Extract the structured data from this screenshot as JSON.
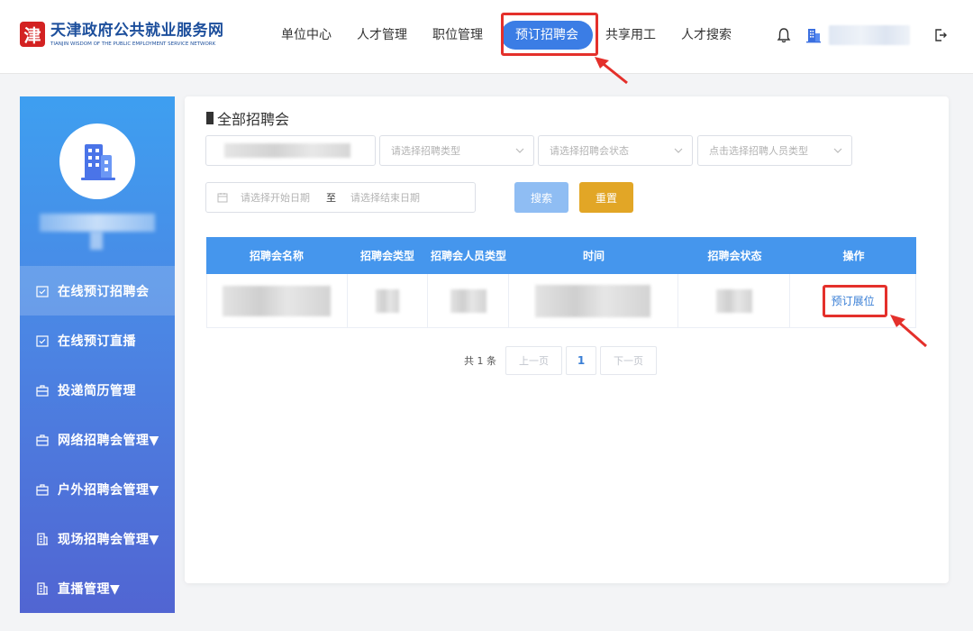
{
  "header": {
    "logo_mark": "津",
    "logo_cn": "天津政府公共就业服务网",
    "logo_en": "TIANJIN WISDOM OF THE PUBLIC EMPLOYMENT SERVICE NETWORK",
    "nav": [
      {
        "label": "单位中心"
      },
      {
        "label": "人才管理"
      },
      {
        "label": "职位管理"
      },
      {
        "label": "预订招聘会",
        "active": true
      },
      {
        "label": "共享用工"
      },
      {
        "label": "人才搜索"
      }
    ],
    "icons": [
      "bell-icon",
      "building-icon",
      "logout-icon"
    ]
  },
  "sidebar": {
    "items": [
      {
        "label": "在线预订招聘会",
        "icon": "calendar-check-icon",
        "active": true
      },
      {
        "label": "在线预订直播",
        "icon": "calendar-check-icon"
      },
      {
        "label": "投递简历管理",
        "icon": "briefcase-icon"
      },
      {
        "label": "网络招聘会管理▼",
        "icon": "briefcase-icon"
      },
      {
        "label": "户外招聘会管理▼",
        "icon": "briefcase-icon"
      },
      {
        "label": "现场招聘会管理▼",
        "icon": "building-icon"
      },
      {
        "label": "直播管理▼",
        "icon": "building-icon"
      }
    ]
  },
  "main": {
    "title": "全部招聘会",
    "filters": {
      "type_placeholder": "请选择招聘类型",
      "status_placeholder": "请选择招聘会状态",
      "person_placeholder": "点击选择招聘人员类型",
      "start_placeholder": "请选择开始日期",
      "range_sep": "至",
      "end_placeholder": "请选择结束日期",
      "search_label": "搜索",
      "reset_label": "重置"
    },
    "table": {
      "columns": [
        "招聘会名称",
        "招聘会类型",
        "招聘会人员类型",
        "时间",
        "招聘会状态",
        "操作"
      ],
      "rows": [
        {
          "action": "预订展位"
        }
      ]
    },
    "pager": {
      "total": "共 1 条",
      "prev": "上一页",
      "current": "1",
      "next": "下一页"
    }
  },
  "colors": {
    "accent": "#3b7de5",
    "table_header": "#4596ed",
    "highlight": "#e4302b",
    "reset": "#e2a626"
  }
}
